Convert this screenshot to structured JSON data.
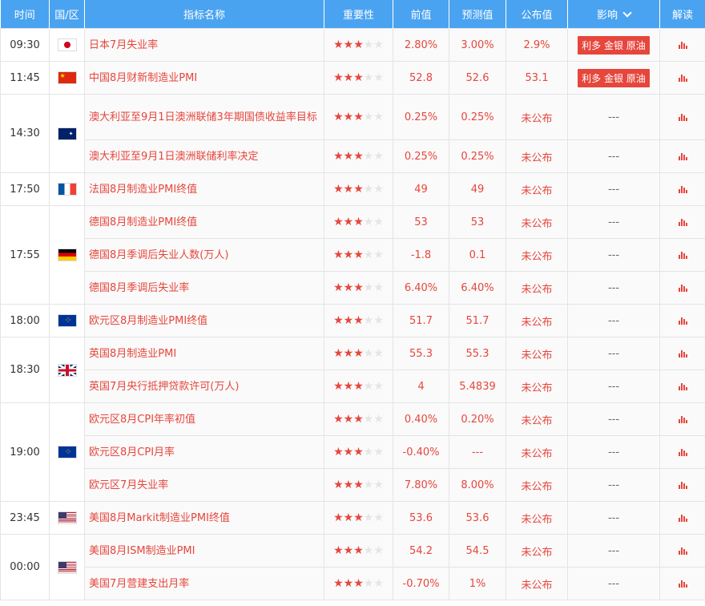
{
  "header": {
    "time": "时间",
    "region": "国/区",
    "indicator": "指标名称",
    "importance": "重要性",
    "previous": "前值",
    "forecast": "预测值",
    "actual": "公布值",
    "impact": "影响",
    "analysis": "解读"
  },
  "colors": {
    "header_bg": "#4aa3f0",
    "accent_red": "#e6463c"
  },
  "groups": [
    {
      "time": "09:30",
      "flag": "jp",
      "rows": [
        {
          "name": "日本7月失业率",
          "stars": 3,
          "previous": "2.80%",
          "forecast": "3.00%",
          "actual": "2.9%",
          "impact": "利多 金银 原油"
        }
      ]
    },
    {
      "time": "11:45",
      "flag": "cn",
      "rows": [
        {
          "name": "中国8月财新制造业PMI",
          "stars": 3,
          "previous": "52.8",
          "forecast": "52.6",
          "actual": "53.1",
          "impact": "利多 金银 原油"
        }
      ]
    },
    {
      "time": "14:30",
      "flag": "au",
      "rows": [
        {
          "name": "澳大利亚至9月1日澳洲联储3年期国债收益率目标",
          "stars": 3,
          "previous": "0.25%",
          "forecast": "0.25%",
          "actual": "未公布",
          "impact": "---"
        },
        {
          "name": "澳大利亚至9月1日澳洲联储利率决定",
          "stars": 3,
          "previous": "0.25%",
          "forecast": "0.25%",
          "actual": "未公布",
          "impact": "---"
        }
      ]
    },
    {
      "time": "17:50",
      "flag": "fr",
      "rows": [
        {
          "name": "法国8月制造业PMI终值",
          "stars": 3,
          "previous": "49",
          "forecast": "49",
          "actual": "未公布",
          "impact": "---"
        }
      ]
    },
    {
      "time": "17:55",
      "flag": "de",
      "rows": [
        {
          "name": "德国8月制造业PMI终值",
          "stars": 3,
          "previous": "53",
          "forecast": "53",
          "actual": "未公布",
          "impact": "---"
        },
        {
          "name": "德国8月季调后失业人数(万人)",
          "stars": 3,
          "previous": "-1.8",
          "forecast": "0.1",
          "actual": "未公布",
          "impact": "---"
        },
        {
          "name": "德国8月季调后失业率",
          "stars": 3,
          "previous": "6.40%",
          "forecast": "6.40%",
          "actual": "未公布",
          "impact": "---"
        }
      ]
    },
    {
      "time": "18:00",
      "flag": "eu",
      "rows": [
        {
          "name": "欧元区8月制造业PMI终值",
          "stars": 3,
          "previous": "51.7",
          "forecast": "51.7",
          "actual": "未公布",
          "impact": "---"
        }
      ]
    },
    {
      "time": "18:30",
      "flag": "uk",
      "rows": [
        {
          "name": "英国8月制造业PMI",
          "stars": 3,
          "previous": "55.3",
          "forecast": "55.3",
          "actual": "未公布",
          "impact": "---"
        },
        {
          "name": "英国7月央行抵押贷款许可(万人)",
          "stars": 3,
          "previous": "4",
          "forecast": "5.4839",
          "actual": "未公布",
          "impact": "---"
        }
      ]
    },
    {
      "time": "19:00",
      "flag": "eu",
      "rows": [
        {
          "name": "欧元区8月CPI年率初值",
          "stars": 3,
          "previous": "0.40%",
          "forecast": "0.20%",
          "actual": "未公布",
          "impact": "---"
        },
        {
          "name": "欧元区8月CPI月率",
          "stars": 3,
          "previous": "-0.40%",
          "forecast": "---",
          "actual": "未公布",
          "impact": "---"
        },
        {
          "name": "欧元区7月失业率",
          "stars": 3,
          "previous": "7.80%",
          "forecast": "8.00%",
          "actual": "未公布",
          "impact": "---"
        }
      ]
    },
    {
      "time": "23:45",
      "flag": "us",
      "rows": [
        {
          "name": "美国8月Markit制造业PMI终值",
          "stars": 3,
          "previous": "53.6",
          "forecast": "53.6",
          "actual": "未公布",
          "impact": "---"
        }
      ]
    },
    {
      "time": "00:00",
      "flag": "us",
      "rows": [
        {
          "name": "美国8月ISM制造业PMI",
          "stars": 3,
          "previous": "54.2",
          "forecast": "54.5",
          "actual": "未公布",
          "impact": "---"
        },
        {
          "name": "美国7月营建支出月率",
          "stars": 3,
          "previous": "-0.70%",
          "forecast": "1%",
          "actual": "未公布",
          "impact": "---"
        }
      ]
    }
  ]
}
